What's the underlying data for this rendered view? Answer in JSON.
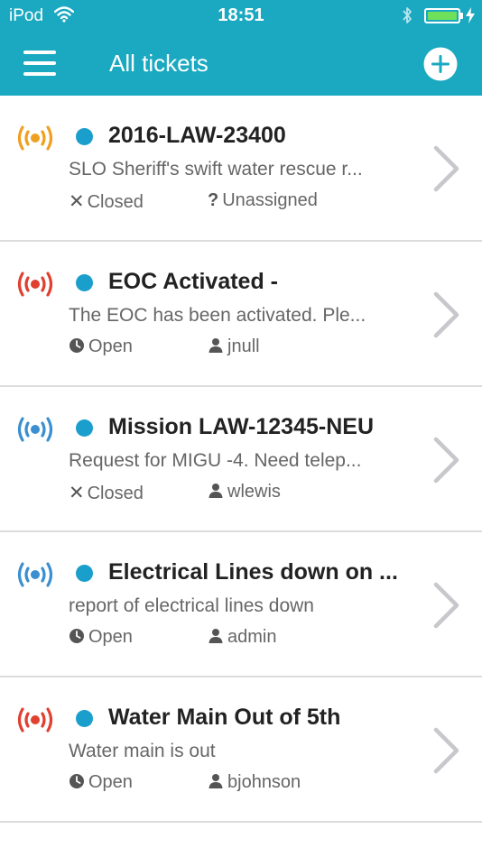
{
  "status_bar": {
    "carrier": "iPod",
    "time": "18:51",
    "battery_color": "#6fe05a"
  },
  "nav": {
    "title": "All tickets",
    "menu_icon": "hamburger-menu-icon",
    "add_icon": "plus-circle-icon",
    "background": "#1aa9c1"
  },
  "tickets": [
    {
      "signal_color": "#f0a020",
      "title": "2016-LAW-23400",
      "description": "SLO Sheriff's swift water rescue r...",
      "status": "Closed",
      "status_icon": "x-icon",
      "assignee": "Unassigned",
      "assignee_icon": "question-icon"
    },
    {
      "signal_color": "#e04030",
      "title": "EOC Activated -",
      "description": "The EOC has been activated. Ple...",
      "status": "Open",
      "status_icon": "clock-icon",
      "assignee": "jnull",
      "assignee_icon": "user-icon"
    },
    {
      "signal_color": "#3a8fd0",
      "title": "Mission LAW-12345-NEU",
      "description": "Request for MIGU -4. Need telep...",
      "status": "Closed",
      "status_icon": "x-icon",
      "assignee": "wlewis",
      "assignee_icon": "user-icon"
    },
    {
      "signal_color": "#3a8fd0",
      "title": "Electrical Lines down on ...",
      "description": "report of electrical lines down",
      "status": "Open",
      "status_icon": "clock-icon",
      "assignee": "admin",
      "assignee_icon": "user-icon"
    },
    {
      "signal_color": "#e04030",
      "title": "Water Main Out of 5th",
      "description": "Water main is out",
      "status": "Open",
      "status_icon": "clock-icon",
      "assignee": "bjohnson",
      "assignee_icon": "user-icon"
    }
  ]
}
